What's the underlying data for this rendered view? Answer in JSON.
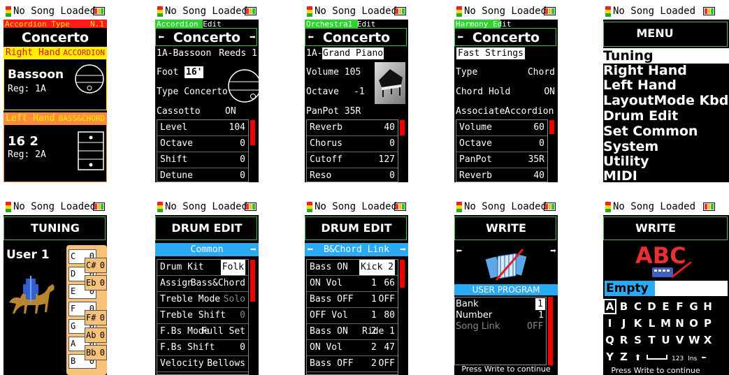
{
  "status": {
    "text": "No Song Loaded"
  },
  "colors": {
    "red": "#ff1a1a",
    "yellow": "#ffee00",
    "orange": "#ff8c3a",
    "green": "#2bd42b",
    "cyan": "#29aaf2",
    "tan": "#f6c27a",
    "scroll": "#e00000",
    "border_green": "#3ec23e"
  },
  "s1": {
    "tag": "Accordion Type",
    "tag_num": "N.1",
    "title": "Concerto",
    "rh_label": "Right Hand",
    "rh_value": "ACCORDION",
    "rh_voice": "Bassoon",
    "rh_reg": "Reg: 1A",
    "lh_label": "Left Hand",
    "lh_value": "BASS&CHORD",
    "lh_voice": "16 2",
    "lh_reg": "Reg: 2A"
  },
  "s2": {
    "tag": "Accordion Edit",
    "title": "Concerto",
    "line1_l": "1A-Bassoon",
    "line1_r": "Reeds 1",
    "foot_label": "Foot",
    "foot_value": "16'",
    "type_line": "Type Concerto",
    "cass_label": "Cassotto",
    "cass_value": "ON",
    "rows": [
      {
        "l": "Level",
        "r": "104"
      },
      {
        "l": "Octave",
        "r": "0"
      },
      {
        "l": "Shift",
        "r": "0"
      },
      {
        "l": "Detune",
        "r": "0"
      }
    ]
  },
  "s3": {
    "tag": "Orchestra1 Edit",
    "title": "Concerto",
    "voice_prefix": "1A-",
    "voice_name": "Grand Piano",
    "vol": "Volume 105",
    "oct_label": "Octave",
    "oct_value": "-1",
    "pan": "PanPot 35R",
    "rows": [
      {
        "l": "Reverb",
        "r": "40"
      },
      {
        "l": "Chorus",
        "r": "0"
      },
      {
        "l": "Cutoff",
        "r": "127"
      },
      {
        "l": "Reso",
        "r": "0"
      }
    ]
  },
  "s4": {
    "tag": "Harmony Edit",
    "title": "Concerto",
    "preset": "Fast Strings",
    "type_label": "Type",
    "type_value": "Chord",
    "hold_label": "Chord Hold",
    "hold_value": "ON",
    "assoc_label": "Associate",
    "assoc_value": "Accordion",
    "rows": [
      {
        "l": "Volume",
        "r": "60"
      },
      {
        "l": "Octave",
        "r": "0"
      },
      {
        "l": "PanPot",
        "r": "35R"
      },
      {
        "l": "Reverb",
        "r": "40"
      }
    ]
  },
  "s5": {
    "title": "MENU",
    "items": [
      "Tuning",
      "Right Hand",
      "Left Hand",
      "LayoutMode Kbd",
      "Drum Edit",
      "Set Common",
      "System",
      "Utility",
      "MIDI"
    ]
  },
  "s6": {
    "title": "TUNING",
    "user": "User 1",
    "white_notes": [
      {
        "n": "C",
        "v": "0"
      },
      {
        "n": "D",
        "v": "0"
      },
      {
        "n": "E",
        "v": "0"
      },
      {
        "n": "F",
        "v": "0"
      },
      {
        "n": "G",
        "v": "0"
      },
      {
        "n": "A",
        "v": "0"
      },
      {
        "n": "B",
        "v": "0"
      }
    ],
    "black_notes": [
      {
        "n": "C#",
        "v": "0"
      },
      {
        "n": "Eb",
        "v": "0"
      },
      {
        "n": "F#",
        "v": "0"
      },
      {
        "n": "Ab",
        "v": "0"
      },
      {
        "n": "Bb",
        "v": "0"
      }
    ]
  },
  "s7": {
    "title": "DRUM EDIT",
    "sub": "Common",
    "rows": [
      {
        "l": "Drum Kit",
        "r": "Folk"
      },
      {
        "l": "Assign",
        "r": "Bass&Chord"
      },
      {
        "l": "Treble Mode",
        "r": "Solo"
      },
      {
        "l": "Treble Shift",
        "r": "0"
      },
      {
        "l": "F.Bs Mode",
        "r": "Full Set"
      },
      {
        "l": "F.Bs Shift",
        "r": "0"
      },
      {
        "l": "Velocity",
        "r": "Bellows"
      }
    ]
  },
  "s8": {
    "title": "DRUM EDIT",
    "sub": "B&Chord Link",
    "rows": [
      {
        "l": "Bass ON",
        "m": "1",
        "r": "Kick 2"
      },
      {
        "l": "ON Vol",
        "m": "1",
        "r": "66"
      },
      {
        "l": "Bass OFF",
        "m": "1",
        "r": "OFF"
      },
      {
        "l": "OFF Vol",
        "m": "1",
        "r": "80"
      },
      {
        "l": "Bass ON",
        "m": "2",
        "r": "Ride 1"
      },
      {
        "l": "ON Vol",
        "m": "2",
        "r": "47"
      },
      {
        "l": "Bass OFF",
        "m": "2",
        "r": "OFF"
      }
    ]
  },
  "s9": {
    "title": "WRITE",
    "band": "USER PROGRAM",
    "bank_label": "Bank",
    "bank_value": "1",
    "num_label": "Number",
    "num_value": "1",
    "link_label": "Song Link",
    "link_value": "OFF",
    "footer": "Press Write to continue"
  },
  "s10": {
    "title": "WRITE",
    "logo": "ABC",
    "name_field": "Empty",
    "keys_row1": [
      "A",
      "B",
      "C",
      "D",
      "E",
      "F",
      "G",
      "H"
    ],
    "keys_row2": [
      "I",
      "J",
      "K",
      "L",
      "M",
      "N",
      "O",
      "P"
    ],
    "keys_row3": [
      "Q",
      "R",
      "S",
      "T",
      "U",
      "V",
      "W",
      "X"
    ],
    "keys_row4": [
      "Y",
      "Z"
    ],
    "key_123": "123",
    "key_ins": "Ins",
    "footer": "Press Write to continue"
  }
}
